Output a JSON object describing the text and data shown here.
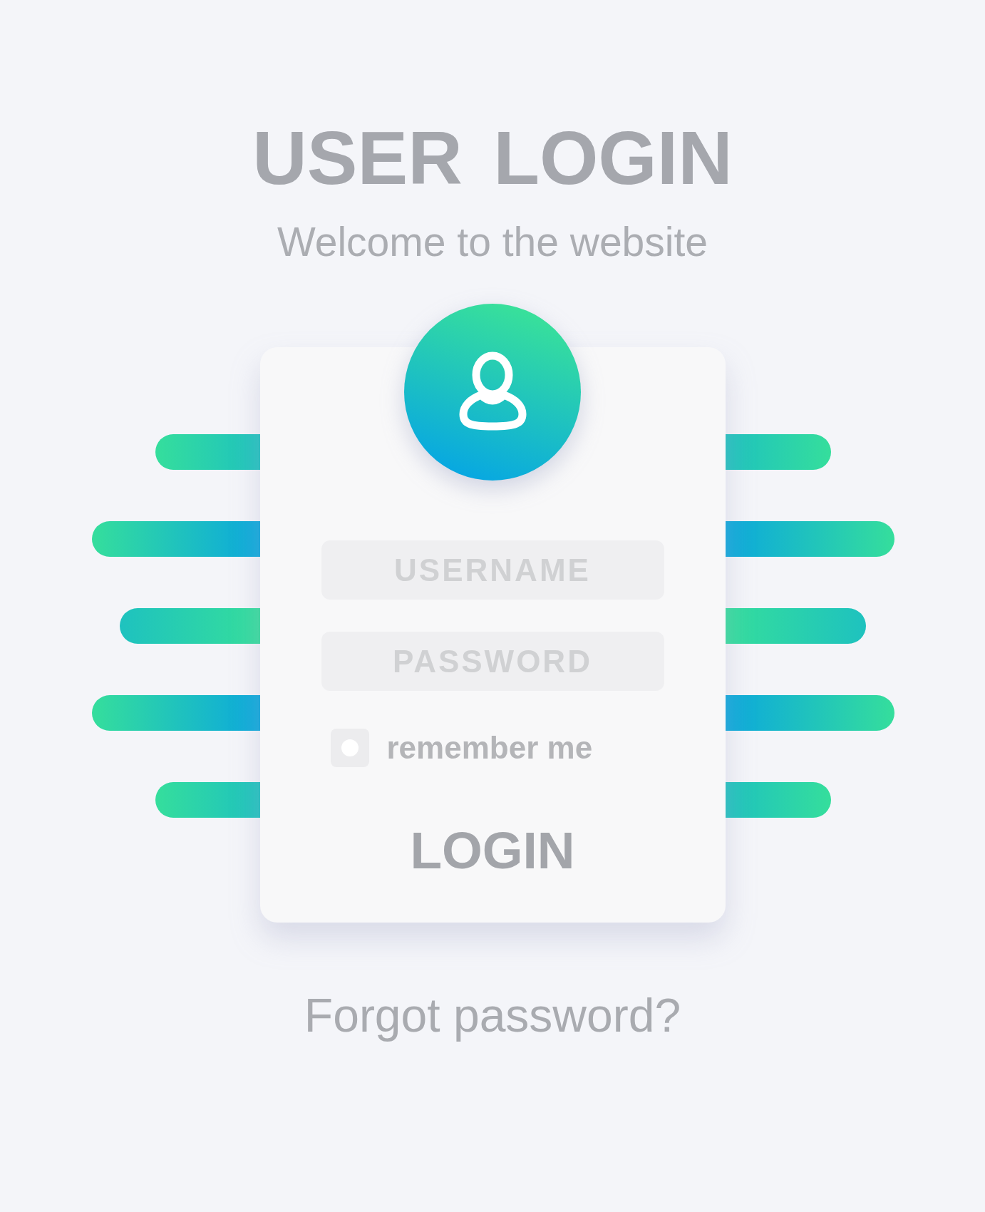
{
  "title": "USER LOGIN",
  "subtitle": "Welcome to the website",
  "form": {
    "fields": [
      {
        "placeholder": "USERNAME"
      },
      {
        "placeholder": "PASSWORD"
      }
    ],
    "remember": {
      "label": "remember me",
      "checked": false
    },
    "submit": "LOGIN"
  },
  "forgot_link": "Forgot password?"
}
